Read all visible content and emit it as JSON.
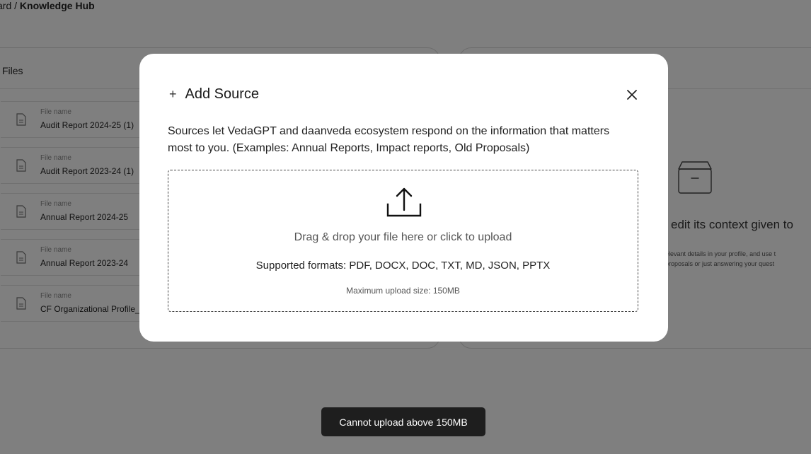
{
  "breadcrumb": {
    "prefix": "ard / ",
    "current": "Knowledge Hub"
  },
  "files_panel": {
    "title": "Files",
    "items": [
      {
        "meta": "File name",
        "name": "Audit Report 2024-25 (1)"
      },
      {
        "meta": "File name",
        "name": "Audit Report 2023-24 (1)"
      },
      {
        "meta": "File name",
        "name": "Annual Report 2024-25"
      },
      {
        "meta": "File name",
        "name": "Annual Report 2023-24"
      },
      {
        "meta": "File name",
        "name": "CF Organizational Profile_..."
      }
    ]
  },
  "context_panel": {
    "empty_title": "edit its context given to",
    "empty_desc_line1": "elevant details in your profile, and use t",
    "empty_desc_line2": "proposals or just answering your quest"
  },
  "modal": {
    "plus_symbol": "+",
    "title": "Add Source",
    "description": "Sources let VedaGPT and daanveda ecosystem respond on the information that matters most to you. (Examples: Annual Reports, Impact reports, Old Proposals)",
    "dropzone": {
      "drop_text": "Drag & drop your file here or click to upload",
      "formats_text": "Supported formats: PDF, DOCX, DOC, TXT, MD, JSON, PPTX",
      "max_text": "Maximum upload size: 150MB"
    }
  },
  "toast": {
    "message": "Cannot upload above 150MB"
  },
  "icons": {
    "close": "close-icon",
    "upload": "upload-icon",
    "file": "file-icon",
    "box": "archive-box-icon",
    "plus": "plus-icon"
  }
}
